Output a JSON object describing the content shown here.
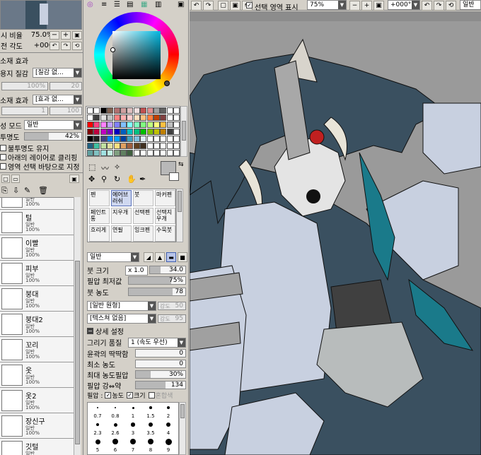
{
  "left_panel": {
    "zoom_label": "시 비율",
    "zoom_value": "75.0%",
    "angle_label": "전 각도",
    "angle_value": "+000",
    "texture_effect_label": "소재 효과",
    "paper_texture_label": "용지 질감",
    "paper_texture_value": "[질감 없...",
    "paper_strength_label": "강도",
    "paper_strength_value": "100%",
    "paper_scale_value": "20",
    "material_effect_label": "소재 효과",
    "material_effect_value": "[효과 없...",
    "material_strength_value": "1",
    "material_value": "100",
    "blend_mode_label": "성 모드",
    "blend_mode_value": "일반",
    "opacity_label": "투명도",
    "opacity_value": "42%",
    "opacity_fraction": 0.42,
    "preserve_opacity_label": "불투명도 유지",
    "clip_label": "아래의 레이어로 클리핑",
    "selection_source_label": "영역 선택 바탕으로 지정"
  },
  "layers": [
    {
      "name": "",
      "mode": "일반",
      "opacity": "100%"
    },
    {
      "name": "털",
      "mode": "일반",
      "opacity": "100%"
    },
    {
      "name": "이빨",
      "mode": "일반",
      "opacity": "100%"
    },
    {
      "name": "피부",
      "mode": "일반",
      "opacity": "100%"
    },
    {
      "name": "붕대",
      "mode": "일반",
      "opacity": "100%"
    },
    {
      "name": "붕대2",
      "mode": "일반",
      "opacity": "100%"
    },
    {
      "name": "꼬리",
      "mode": "일반",
      "opacity": "100%"
    },
    {
      "name": "옷",
      "mode": "일반",
      "opacity": "100%"
    },
    {
      "name": "옷2",
      "mode": "일반",
      "opacity": "100%"
    },
    {
      "name": "장신구",
      "mode": "일반",
      "opacity": "100%"
    },
    {
      "name": "깃털",
      "mode": "일반",
      "opacity": "100%"
    }
  ],
  "tools": [
    {
      "label": "펜"
    },
    {
      "label": "에어브러쉬"
    },
    {
      "label": "붓"
    },
    {
      "label": "마커펜"
    },
    {
      "label": "페인트통"
    },
    {
      "label": "지우개"
    },
    {
      "label": "선택펜"
    },
    {
      "label": "선택지우개"
    },
    {
      "label": "흐리게"
    },
    {
      "label": "연필"
    },
    {
      "label": "잉크펜"
    },
    {
      "label": "수묵붓"
    }
  ],
  "brush": {
    "mode_value": "일반",
    "size_label": "붓 크기",
    "size_mult": "x 1.0",
    "size_value": "34.0",
    "min_size_label": "필압 최저값",
    "min_size_value": "75%",
    "density_label": "붓 농도",
    "density_value": "78",
    "shape_value": "[일반 원형]",
    "shape_strength_label": "강도",
    "shape_strength_value": "50",
    "texture_value": "[텍스쳐 없음]",
    "texture_strength_label": "강도",
    "texture_strength_value": "95",
    "advanced_label": "상세 설정",
    "quality_label": "그리기 품질",
    "quality_value": "1 (속도 우선)",
    "edge_label": "윤곽의 딱딱함",
    "edge_value": "0",
    "min_density_label": "최소 농도",
    "min_density_value": "0",
    "max_density_label": "최대 농도필압",
    "max_density_value": "30%",
    "pressure_label": "필압 강⇔약",
    "pressure_value": "134",
    "pressure_opts_label": "필압 :",
    "pressure_density": "농도",
    "pressure_size": "크기",
    "pressure_blend": "혼합색"
  },
  "brush_sizes": [
    "0.7",
    "0.8",
    "1",
    "1.5",
    "2",
    "2.3",
    "2.6",
    "3",
    "3.5",
    "4",
    "5",
    "6",
    "7",
    "8",
    "9"
  ],
  "toolbar": {
    "selection_show_label": "선택 영역 표시",
    "zoom_value": "75%",
    "angle_value": "+000°",
    "blend_value": "일반"
  },
  "palette_colors": [
    "#ffffff",
    "#ffffff",
    "#000000",
    "#806050",
    "#b07070",
    "#d0a0a0",
    "#e0c0c0",
    "#f0e0e0",
    "#c05050",
    "#e09090",
    "#a0a0a0",
    "#606060",
    "#ffffff",
    "#ffffff",
    "#ffffff",
    "#404040",
    "#e0e0e0",
    "#c0c0c0",
    "#ff8080",
    "#ffb0b0",
    "#ffd0d0",
    "#ffe0c0",
    "#ffc080",
    "#ff8040",
    "#c04000",
    "#804040",
    "#ffffff",
    "#ffffff",
    "#ff0000",
    "#ff4080",
    "#ff80ff",
    "#c0a0ff",
    "#8080ff",
    "#80c0ff",
    "#80ffff",
    "#80ffc0",
    "#80ff80",
    "#c0ff80",
    "#ffff80",
    "#ffc040",
    "#c0c0c0",
    "#ffffff",
    "#800000",
    "#c00040",
    "#c000c0",
    "#8000c0",
    "#0000c0",
    "#0060c0",
    "#00c0c0",
    "#00c080",
    "#00c000",
    "#80c000",
    "#c0c000",
    "#c08000",
    "#404040",
    "#ffffff",
    "#000000",
    "#202020",
    "#404080",
    "#0080ff",
    "#00a0ff",
    "#0040a0",
    "#40a0c0",
    "#80c0e0",
    "#e0f0ff",
    "#ffffff",
    "#ffffff",
    "#ffffff",
    "#ffffff",
    "#ffffff",
    "#206080",
    "#40c0a0",
    "#c0e0a0",
    "#e0e0a0",
    "#ffe080",
    "#e0a060",
    "#a06040",
    "#604020",
    "#403020",
    "#ffffff",
    "#ffffff",
    "#ffffff",
    "#ffffff",
    "#ffffff",
    "#60a0a0",
    "#80c0c0",
    "#a0e0e0",
    "#c0f0e0",
    "#80a080",
    "#608060",
    "#406040",
    "#ffffff",
    "#ffffff",
    "#ffffff",
    "#ffffff",
    "#ffffff",
    "#ffffff",
    "#ffffff"
  ],
  "colors": {
    "canvas_bg": "#8c8c8c",
    "fur": "#3a5060",
    "skin": "#c8d0e0",
    "bandage": "#909090",
    "accent_teal": "#1a7a8a",
    "primary_color": "#b8b8b8"
  }
}
